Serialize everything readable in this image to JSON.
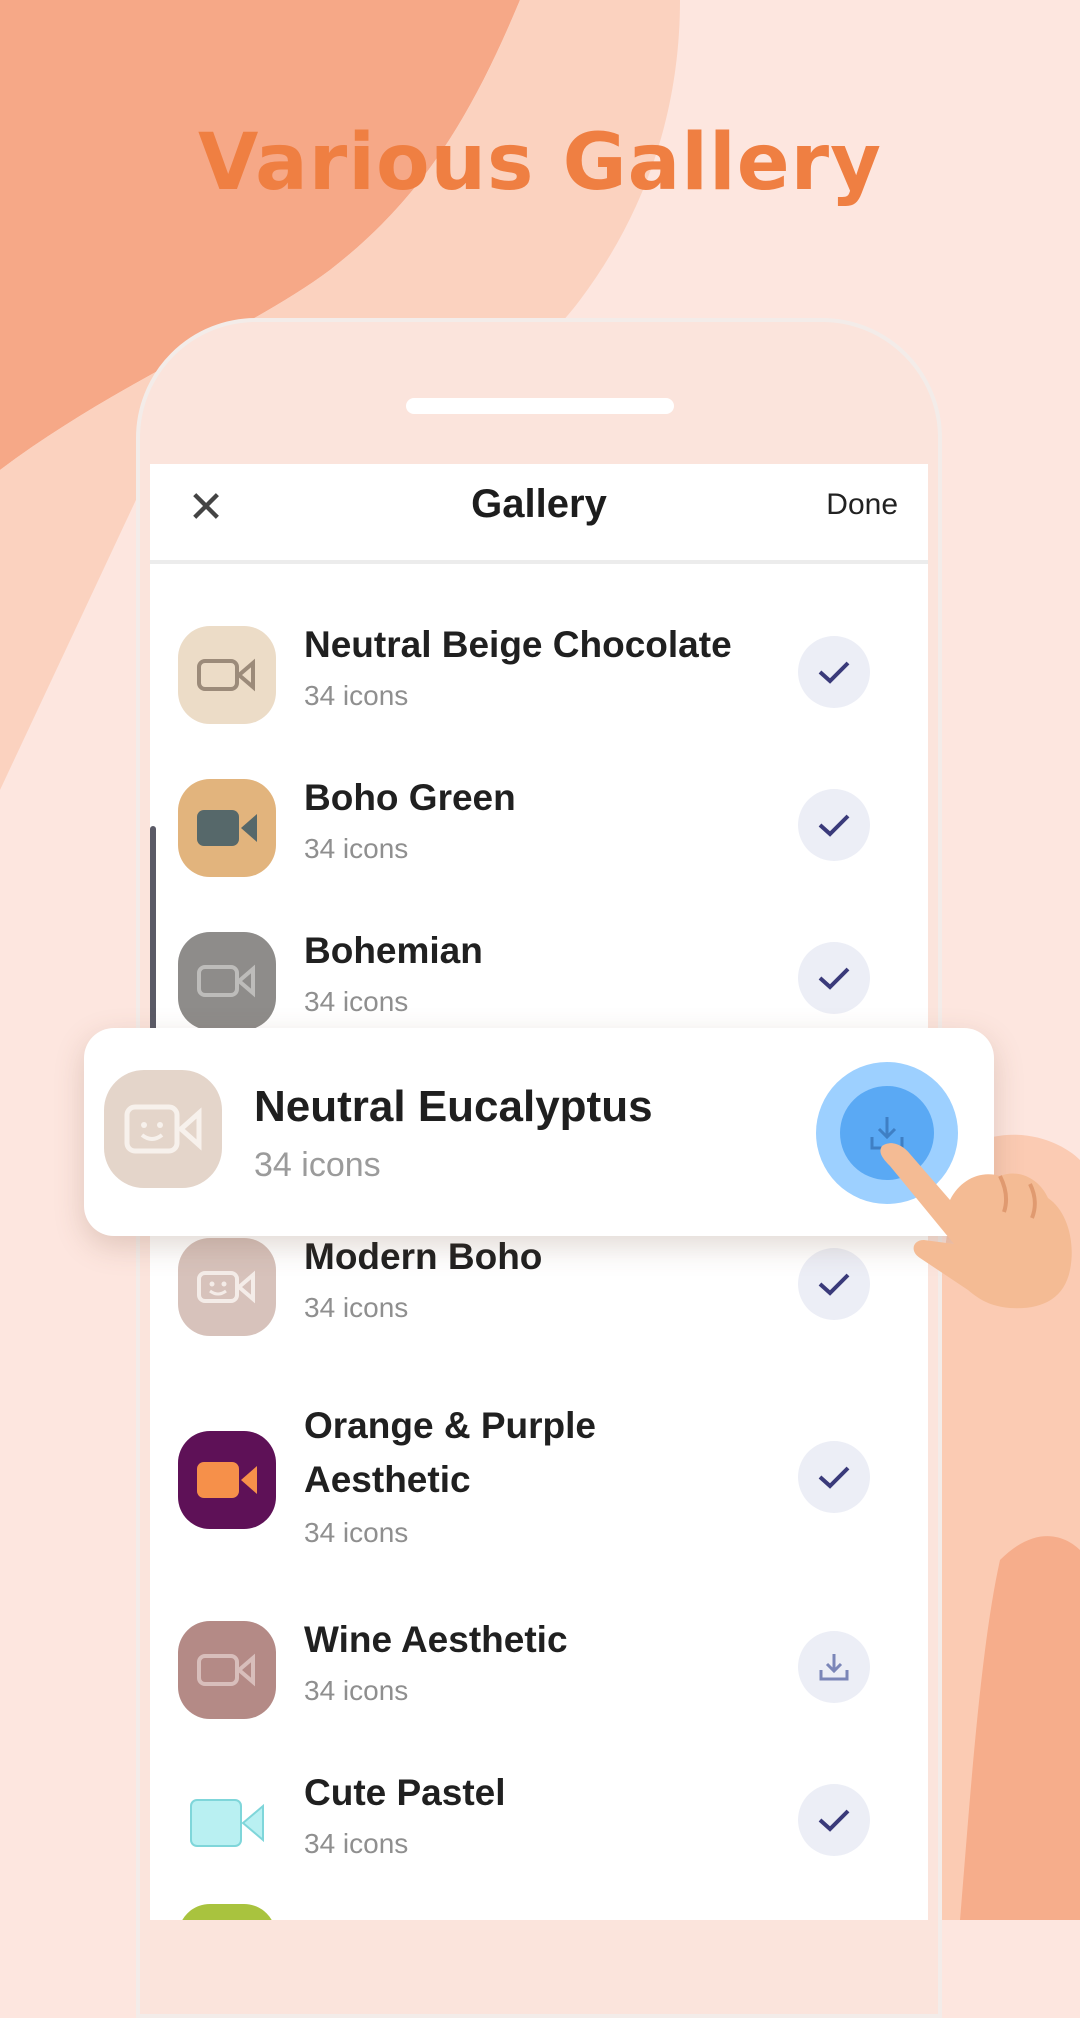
{
  "headline": "Various Gallery",
  "colors": {
    "accent": "#ef7f42",
    "check": "#3a3a7a",
    "download_blue": "#5aa9f4"
  },
  "gallery": {
    "title": "Gallery",
    "close_icon": "close-icon",
    "done_label": "Done",
    "items": [
      {
        "name": "Neutral Beige Chocolate",
        "count": "34 icons",
        "status": "installed",
        "thumb_bg": "#ecdcc7",
        "icon_color": "#9c8b7a"
      },
      {
        "name": "Boho Green",
        "count": "34 icons",
        "status": "installed",
        "thumb_bg": "#e2b47d",
        "icon_color": "#56686a"
      },
      {
        "name": "Bohemian",
        "count": "34 icons",
        "status": "installed",
        "thumb_bg": "#8e8c8a",
        "icon_color": "#bdbcba"
      },
      {
        "name": "Modern Boho",
        "count": "34 icons",
        "status": "installed",
        "thumb_bg": "#d7c2bb",
        "icon_color": "#f4ece8"
      },
      {
        "name": "Orange & Purple",
        "name_line2": "Aesthetic",
        "count": "34 icons",
        "status": "installed",
        "thumb_bg": "#5e1157",
        "icon_color": "#f6904a"
      },
      {
        "name": "Wine Aesthetic",
        "count": "34 icons",
        "status": "download",
        "thumb_bg": "#b48a86",
        "icon_color": "#d8bebb"
      },
      {
        "name": "Cute Pastel",
        "count": "34 icons",
        "status": "installed",
        "thumb_bg": "#ffffff",
        "icon_color": "#b9f0f2"
      }
    ]
  },
  "highlight": {
    "name": "Neutral Eucalyptus",
    "count": "34 icons",
    "action": "download-icon"
  }
}
